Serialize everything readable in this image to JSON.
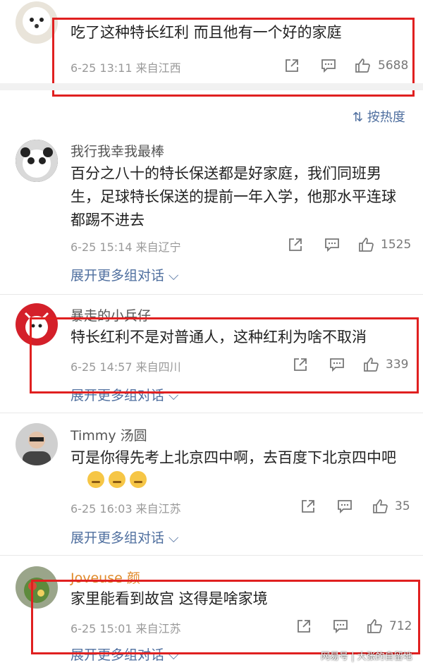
{
  "comments": [
    {
      "username": "",
      "text": "吃了这种特长红利 而且他有一个好的家庭",
      "time": "6-25 13:11",
      "location": "来自江西",
      "likes": "5688"
    },
    {
      "username": "我行我幸我最棒",
      "text": "百分之八十的特长保送都是好家庭，我们同班男生，足球特长保送的提前一年入学，他那水平连球都踢不进去",
      "time": "6-25 15:14",
      "location": "来自辽宁",
      "likes": "1525",
      "expand": "展开更多组对话 ⌵"
    },
    {
      "username": "暴走的小兵仔",
      "text": "特长红利不是对普通人，这种红利为啥不取消",
      "time": "6-25 14:57",
      "location": "来自四川",
      "likes": "339",
      "expand": "展开更多组对话 ⌵"
    },
    {
      "username": "Timmy 汤圆",
      "text": "可是你得先考上北京四中啊，去百度下北京四中吧",
      "time": "6-25 16:03",
      "location": "来自江苏",
      "likes": "35",
      "expand": "展开更多组对话 ⌵"
    },
    {
      "username": "Joveuse 颜",
      "text": "家里能看到故宫 这得是啥家境",
      "time": "6-25 15:01",
      "location": "来自江苏",
      "likes": "712",
      "expand": "展开更多组对话 ⌵"
    }
  ],
  "sort_label": "按热度",
  "watermark": "网易号 | 大张的自留地",
  "icons": {
    "share": "share-icon",
    "comment": "comment-icon",
    "like": "thumbs-up-icon"
  }
}
